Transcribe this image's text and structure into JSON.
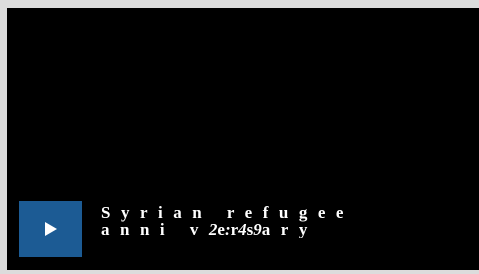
{
  "player": {
    "caption_line1": "Syrian refugee",
    "caption_line2_parts": [
      "anni v",
      "2",
      "e",
      ":",
      "r",
      "4",
      "s",
      "9",
      "ary"
    ],
    "play_icon": "play-icon",
    "colors": {
      "video_bg": "#000000",
      "play_button_bg": "#1c5b94",
      "caption_text": "#ffffff",
      "frame_bg": "#dcdcdc"
    }
  }
}
